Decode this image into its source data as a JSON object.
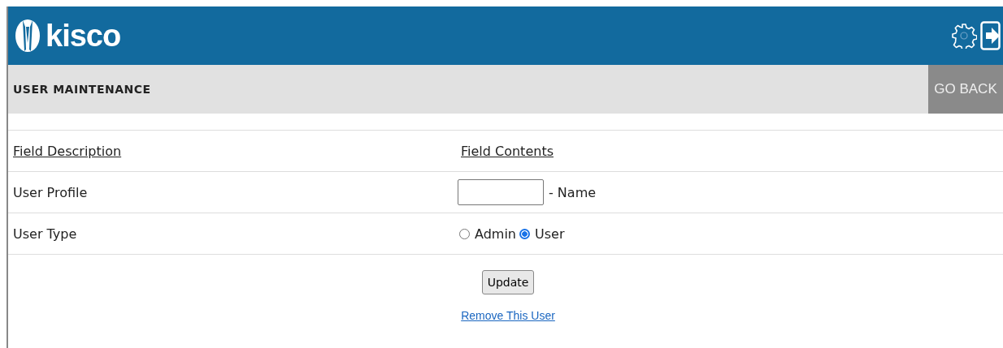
{
  "header": {
    "logo_text": "kisco"
  },
  "title_bar": {
    "title": "USER MAINTENANCE",
    "back_button": "GO BACK"
  },
  "table": {
    "columns": [
      "Field Description",
      "Field Contents"
    ],
    "rows": [
      {
        "kind": "text_input",
        "label": "User Profile",
        "suffix": "- Name"
      },
      {
        "kind": "radio",
        "label": "User Type",
        "options": [
          {
            "label": "Admin",
            "selected": false
          },
          {
            "label": "User",
            "selected": true
          }
        ]
      }
    ]
  },
  "actions": {
    "button": "Update",
    "link": "Remove This User"
  }
}
